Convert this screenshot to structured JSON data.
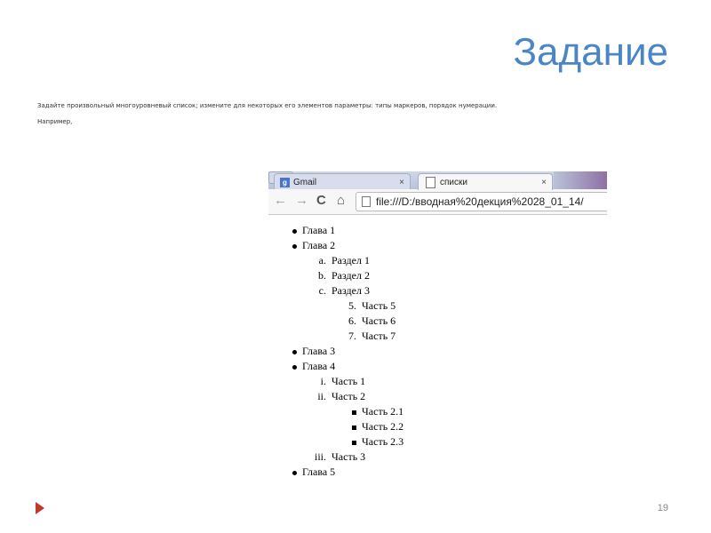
{
  "slide": {
    "title": "Задание",
    "instruction": "Задайте произвольный многоуровневый список; измените для некоторых его элементов параметры: типы маркеров, порядок нумерации.",
    "example": "Например,",
    "page_number": "19"
  },
  "browser": {
    "tabs": [
      {
        "label": "Gmail",
        "close": "×",
        "icon": "gmail-favicon"
      },
      {
        "label": "списки",
        "close": "×",
        "icon": "page-icon"
      }
    ],
    "url": "file:///D:/вводная%20декция%2028_01_14/",
    "toolbar_icons": {
      "back": "←",
      "forward": "→",
      "reload": "C",
      "home": "⌂"
    }
  },
  "list": {
    "ch1": "Глава 1",
    "ch2": "Глава 2",
    "ch2_items": [
      {
        "marker": "a.",
        "label": "Раздел 1"
      },
      {
        "marker": "b.",
        "label": "Раздел 2"
      },
      {
        "marker": "c.",
        "label": "Раздел 3"
      }
    ],
    "ch2_sub": [
      {
        "marker": "5.",
        "label": "Часть 5"
      },
      {
        "marker": "6.",
        "label": "Часть 6"
      },
      {
        "marker": "7.",
        "label": "Часть 7"
      }
    ],
    "ch3": "Глава 3",
    "ch4": "Глава 4",
    "ch4_items": [
      {
        "marker": "i.",
        "label": "Часть 1"
      },
      {
        "marker": "ii.",
        "label": "Часть 2"
      }
    ],
    "ch4_sub": [
      {
        "label": "Часть 2.1"
      },
      {
        "label": "Часть 2.2"
      },
      {
        "label": "Часть 2.3"
      }
    ],
    "ch4_last": {
      "marker": "iii.",
      "label": "Часть 3"
    },
    "ch5": "Глава 5"
  }
}
